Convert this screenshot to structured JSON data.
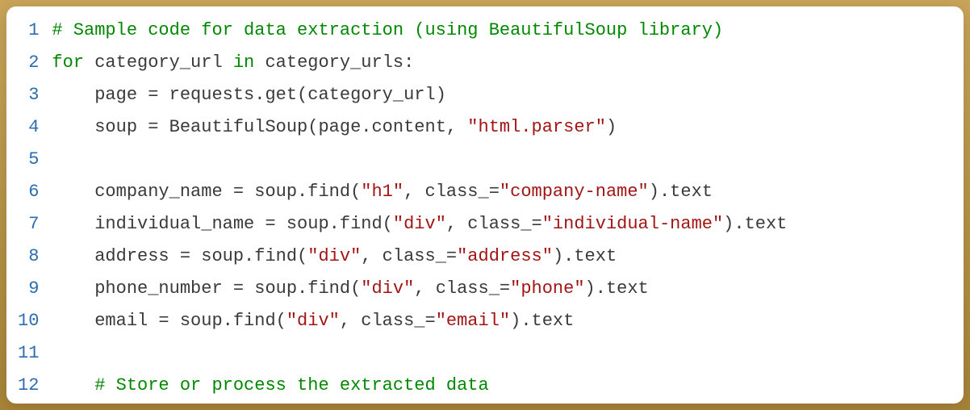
{
  "code": {
    "lines": [
      {
        "indent": 0,
        "tokens": [
          {
            "t": "# Sample code for data extraction (using BeautifulSoup library)",
            "cls": "tok-comment"
          }
        ]
      },
      {
        "indent": 0,
        "tokens": [
          {
            "t": "for",
            "cls": "tok-keyword"
          },
          {
            "t": " category_url ",
            "cls": "tok-ident"
          },
          {
            "t": "in",
            "cls": "tok-keyword"
          },
          {
            "t": " category_urls:",
            "cls": "tok-ident"
          }
        ]
      },
      {
        "indent": 1,
        "tokens": [
          {
            "t": "page = requests.get(category_url)",
            "cls": "tok-ident"
          }
        ]
      },
      {
        "indent": 1,
        "tokens": [
          {
            "t": "soup = BeautifulSoup(page.content, ",
            "cls": "tok-ident"
          },
          {
            "t": "\"html.parser\"",
            "cls": "tok-string"
          },
          {
            "t": ")",
            "cls": "tok-ident"
          }
        ]
      },
      {
        "indent": 0,
        "tokens": []
      },
      {
        "indent": 1,
        "tokens": [
          {
            "t": "company_name = soup.find(",
            "cls": "tok-ident"
          },
          {
            "t": "\"h1\"",
            "cls": "tok-string"
          },
          {
            "t": ", class_=",
            "cls": "tok-ident"
          },
          {
            "t": "\"company-name\"",
            "cls": "tok-string"
          },
          {
            "t": ").text",
            "cls": "tok-ident"
          }
        ]
      },
      {
        "indent": 1,
        "tokens": [
          {
            "t": "individual_name = soup.find(",
            "cls": "tok-ident"
          },
          {
            "t": "\"div\"",
            "cls": "tok-string"
          },
          {
            "t": ", class_=",
            "cls": "tok-ident"
          },
          {
            "t": "\"individual-name\"",
            "cls": "tok-string"
          },
          {
            "t": ").text",
            "cls": "tok-ident"
          }
        ]
      },
      {
        "indent": 1,
        "tokens": [
          {
            "t": "address = soup.find(",
            "cls": "tok-ident"
          },
          {
            "t": "\"div\"",
            "cls": "tok-string"
          },
          {
            "t": ", class_=",
            "cls": "tok-ident"
          },
          {
            "t": "\"address\"",
            "cls": "tok-string"
          },
          {
            "t": ").text",
            "cls": "tok-ident"
          }
        ]
      },
      {
        "indent": 1,
        "tokens": [
          {
            "t": "phone_number = soup.find(",
            "cls": "tok-ident"
          },
          {
            "t": "\"div\"",
            "cls": "tok-string"
          },
          {
            "t": ", class_=",
            "cls": "tok-ident"
          },
          {
            "t": "\"phone\"",
            "cls": "tok-string"
          },
          {
            "t": ").text",
            "cls": "tok-ident"
          }
        ]
      },
      {
        "indent": 1,
        "tokens": [
          {
            "t": "email = soup.find(",
            "cls": "tok-ident"
          },
          {
            "t": "\"div\"",
            "cls": "tok-string"
          },
          {
            "t": ", class_=",
            "cls": "tok-ident"
          },
          {
            "t": "\"email\"",
            "cls": "tok-string"
          },
          {
            "t": ").text",
            "cls": "tok-ident"
          }
        ]
      },
      {
        "indent": 0,
        "tokens": []
      },
      {
        "indent": 1,
        "tokens": [
          {
            "t": "# Store or process the extracted data",
            "cls": "tok-comment"
          }
        ]
      }
    ],
    "indent_unit": "    "
  }
}
